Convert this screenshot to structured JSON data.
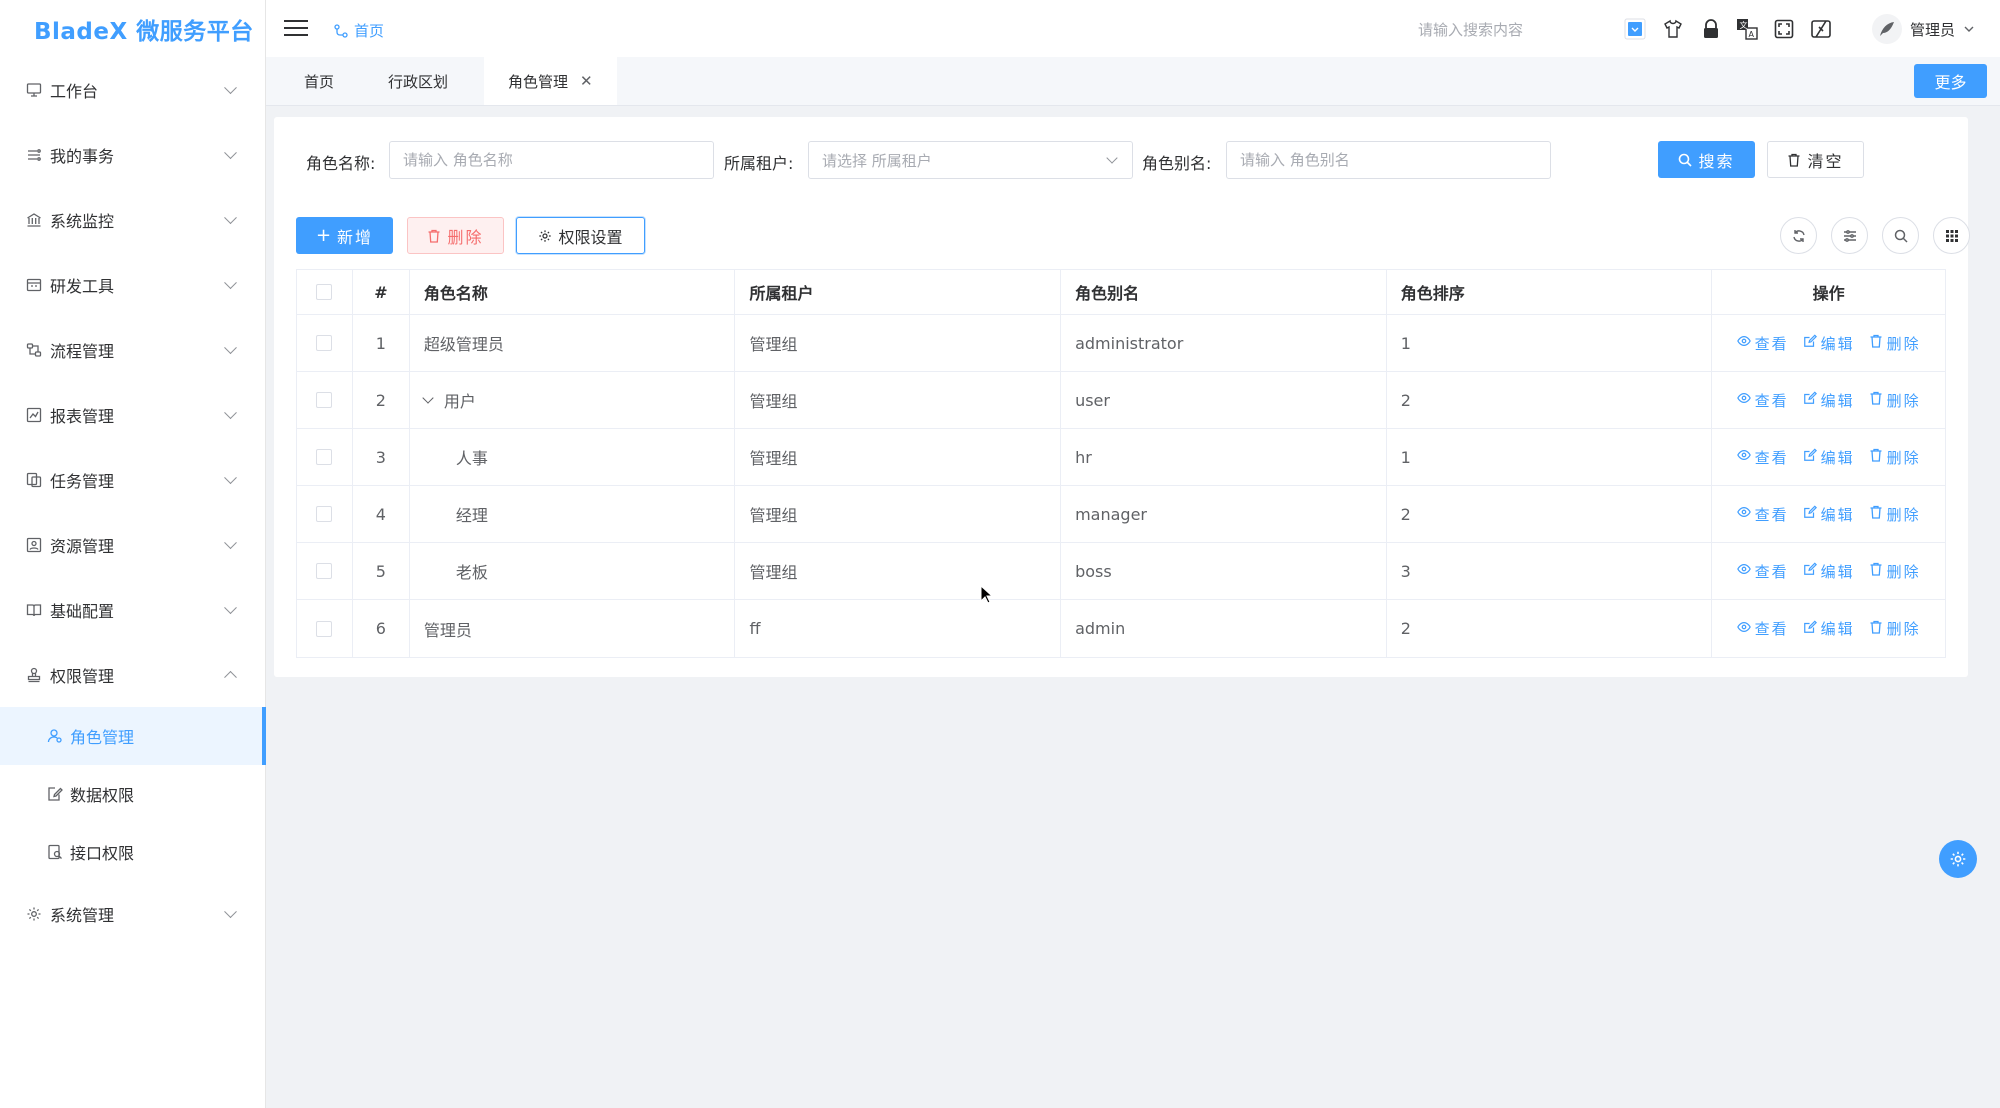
{
  "app": {
    "logo": "BladeX 微服务平台"
  },
  "navbar": {
    "breadcrumb": "首页",
    "search_placeholder": "请输入搜索内容",
    "user_name": "管理员"
  },
  "sidebar": {
    "items": [
      {
        "label": "工作台",
        "icon": "monitor-icon"
      },
      {
        "label": "我的事务",
        "icon": "tasks-icon"
      },
      {
        "label": "系统监控",
        "icon": "bank-icon"
      },
      {
        "label": "研发工具",
        "icon": "calendar-icon"
      },
      {
        "label": "流程管理",
        "icon": "flow-icon"
      },
      {
        "label": "报表管理",
        "icon": "chart-icon"
      },
      {
        "label": "任务管理",
        "icon": "task-icon"
      },
      {
        "label": "资源管理",
        "icon": "resource-icon"
      },
      {
        "label": "基础配置",
        "icon": "book-icon"
      },
      {
        "label": "权限管理",
        "icon": "stamp-icon"
      },
      {
        "label": "系统管理",
        "icon": "gear-icon"
      }
    ],
    "sub_items": [
      {
        "label": "角色管理",
        "icon": "user-icon",
        "active": true
      },
      {
        "label": "数据权限",
        "icon": "edit-doc-icon",
        "active": false
      },
      {
        "label": "接口权限",
        "icon": "api-icon",
        "active": false
      }
    ]
  },
  "tags": {
    "items": [
      "首页",
      "行政区划",
      "角色管理"
    ],
    "active": "角色管理",
    "more_label": "更多"
  },
  "search_form": {
    "role_name_label": "角色名称:",
    "role_name_placeholder": "请输入 角色名称",
    "tenant_label": "所属租户:",
    "tenant_placeholder": "请选择 所属租户",
    "alias_label": "角色别名:",
    "alias_placeholder": "请输入 角色别名",
    "search_button": "搜索",
    "clear_button": "清空"
  },
  "toolbar": {
    "add_button": "新增",
    "delete_button": "删除",
    "permission_button": "权限设置"
  },
  "table": {
    "headers": {
      "index": "#",
      "name": "角色名称",
      "tenant": "所属租户",
      "alias": "角色别名",
      "sort": "角色排序",
      "ops": "操作"
    },
    "op_labels": {
      "view": "查看",
      "edit": "编辑",
      "delete": "删除"
    },
    "rows": [
      {
        "index": "1",
        "name": "超级管理员",
        "tenant": "管理组",
        "alias": "administrator",
        "sort": "1"
      },
      {
        "index": "2",
        "name": "用户",
        "tenant": "管理组",
        "alias": "user",
        "sort": "2"
      },
      {
        "index": "3",
        "name": "人事",
        "tenant": "管理组",
        "alias": "hr",
        "sort": "1"
      },
      {
        "index": "4",
        "name": "经理",
        "tenant": "管理组",
        "alias": "manager",
        "sort": "2"
      },
      {
        "index": "5",
        "name": "老板",
        "tenant": "管理组",
        "alias": "boss",
        "sort": "3"
      },
      {
        "index": "6",
        "name": "管理员",
        "tenant": "ff",
        "alias": "admin",
        "sort": "2"
      }
    ]
  },
  "colors": {
    "primary": "#409eff",
    "danger": "#f56c6c",
    "bg": "#f0f2f5"
  }
}
